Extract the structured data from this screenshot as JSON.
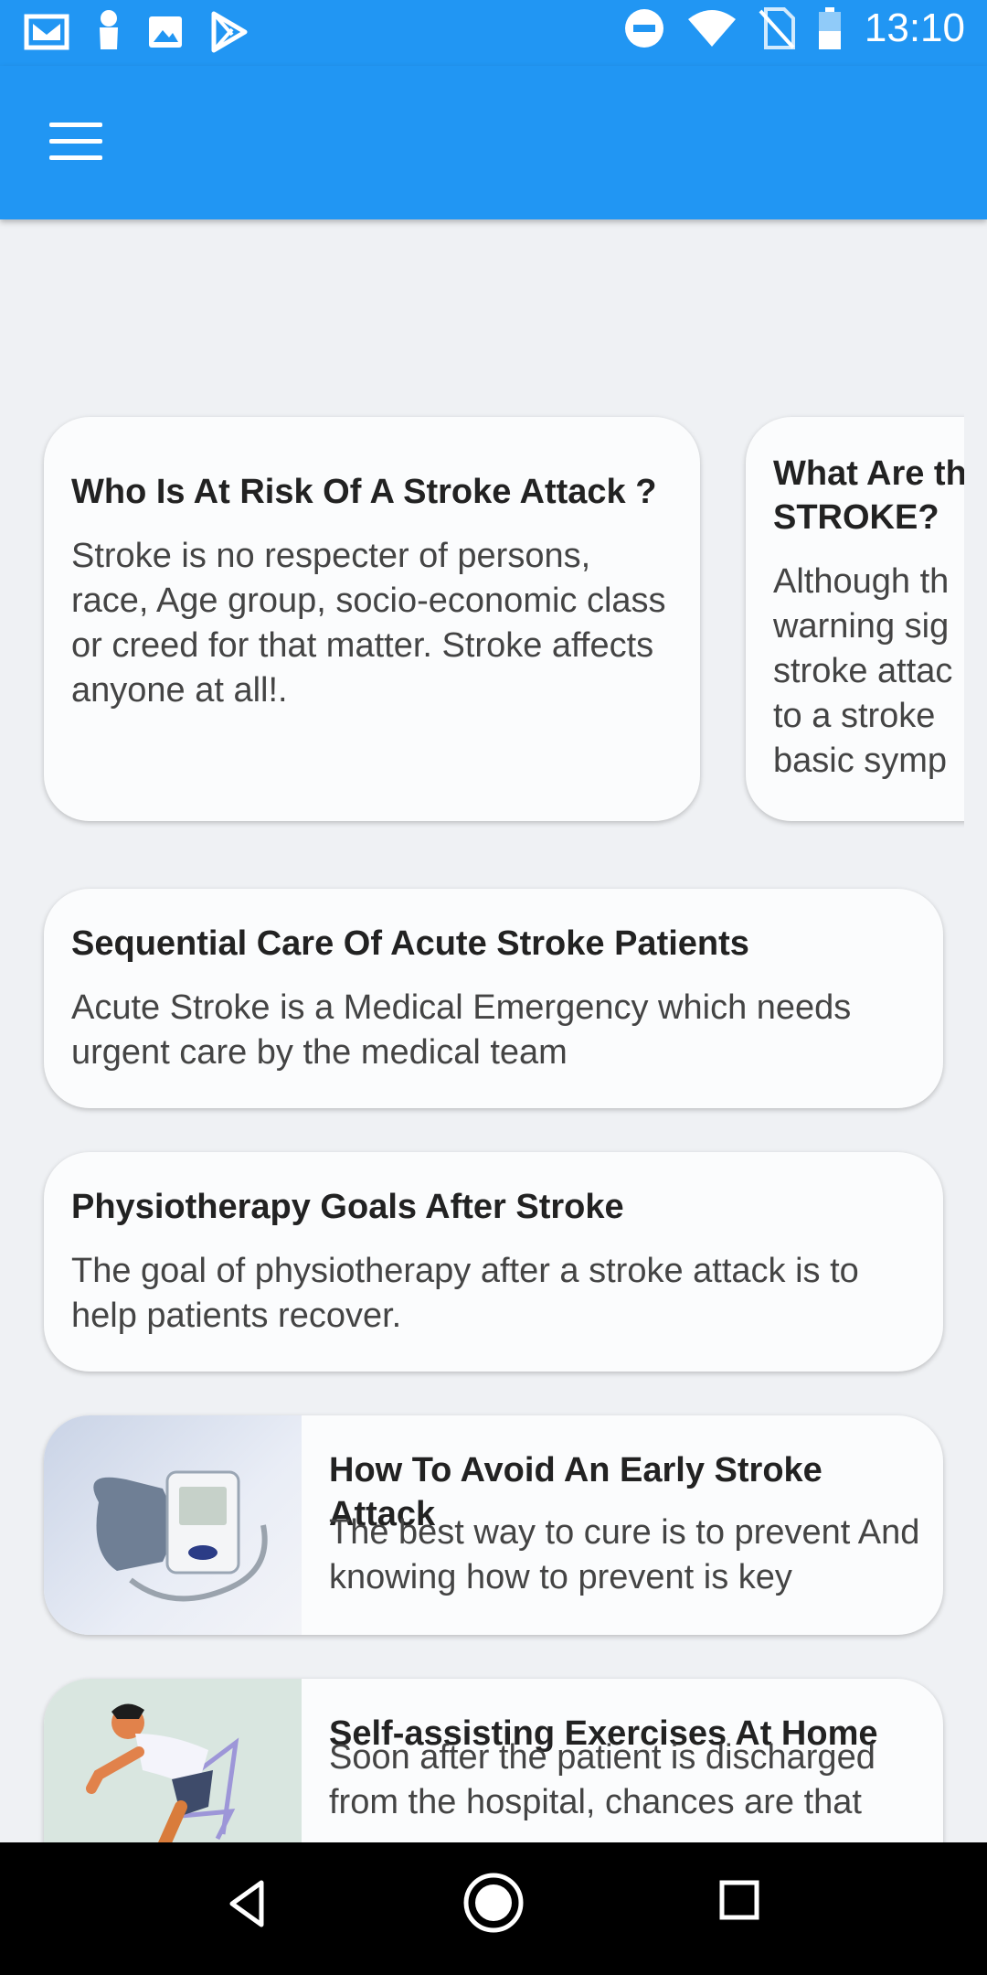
{
  "status_bar": {
    "time": "13:10",
    "left_icons": [
      "gmail-icon",
      "notification-icon",
      "image-icon",
      "play-store-icon"
    ],
    "right_icons": [
      "do-not-disturb-icon",
      "wifi-icon",
      "no-sim-icon",
      "battery-icon"
    ]
  },
  "app_bar": {
    "menu_icon": "hamburger-menu-icon",
    "color": "#2196f3"
  },
  "featured": [
    {
      "title": "Who Is At Risk Of A Stroke Attack ?",
      "body": "Stroke is no respecter of persons, race, Age group, socio-economic class or creed for that matter. Stroke affects anyone at all!."
    },
    {
      "title": "What Are th STROKE?",
      "body": "Although th warning sig stroke attac to a stroke basic symp"
    }
  ],
  "articles": [
    {
      "title": "Sequential Care Of Acute Stroke Patients",
      "body": "Acute Stroke is a Medical Emergency which needs urgent care by the medical team"
    },
    {
      "title": "Physiotherapy Goals After Stroke",
      "body": "The goal of physiotherapy after a stroke attack is to help patients recover."
    },
    {
      "title": "How To Avoid An Early Stroke Attack",
      "body": "The best way to cure is to prevent And knowing how to prevent is key",
      "image": "blood-pressure-monitor-image"
    },
    {
      "title": "Self-assisting Exercises At Home",
      "body": "Soon after the patient is discharged from the hospital, chances are that",
      "image": "exercise-illustration-image"
    }
  ],
  "nav_bar": {
    "buttons": [
      "back-icon",
      "home-icon",
      "recents-icon"
    ]
  }
}
